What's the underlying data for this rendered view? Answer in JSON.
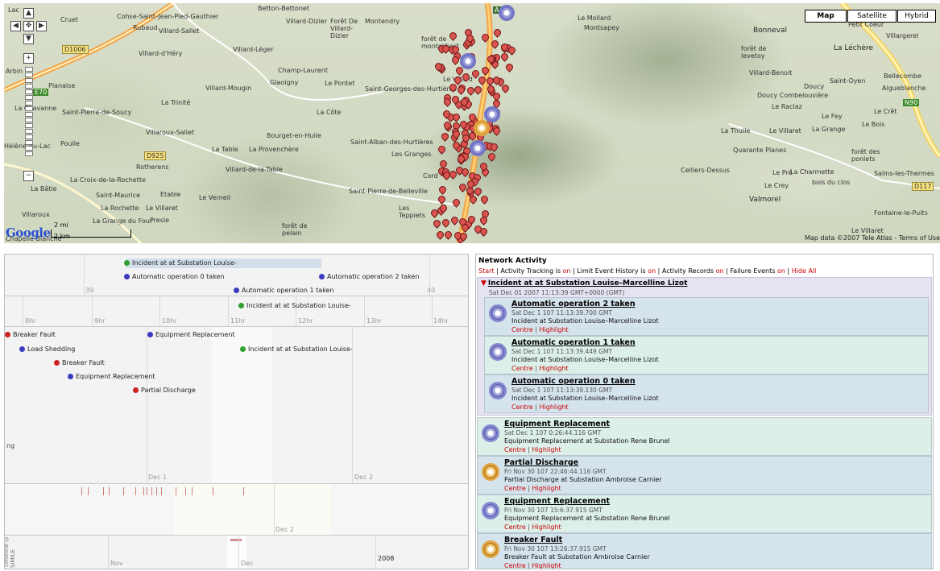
{
  "map": {
    "type_buttons": {
      "map": "Map",
      "satellite": "Satellite",
      "hybrid": "Hybrid"
    },
    "scale": {
      "miles": "2 mi",
      "km": "2 km"
    },
    "logo": "Google",
    "copyright": "Map data ©2007 Tele Atlas - Terms of Use",
    "places": [
      "Lac",
      "Cruet",
      "Cohse-Saint-Jean-Pied-Gauthier",
      "Rubaud",
      "Villard-Sallet",
      "Villard-Dizier",
      "Forêt De Villard-Dizier",
      "Montendry",
      "Betton-Bettonet",
      "forêt de montgilbert",
      "Le Mollard",
      "Montsapey",
      "Bonneval",
      "Petit Coeur",
      "Villargerel",
      "La Léchère",
      "forêt de levetoy",
      "Saint-Oyen",
      "Bellecombe",
      "Aigueblanche",
      "Villard-Benoit",
      "Doucy",
      "Doucy Combelouvière",
      "Le Raclaz",
      "Le Crêt",
      "Le Fey",
      "Le Bois",
      "La Thuile",
      "Le Villaret",
      "La Grange",
      "Quarante Planes",
      "forêt des ponlets",
      "Celliers-Dessus",
      "Le Pré",
      "La Charmette",
      "bois du clos",
      "Salins-les-Thermes",
      "Le Crey",
      "Valmorel",
      "Fontaine-le-Puits",
      "Le Villaret",
      "Arbin",
      "Planaise",
      "La Chavanne",
      "Saint-Pierre-de-Soucy",
      "La Trinité",
      "Villard-d'Héry",
      "Villard-Léger",
      "Champ-Laurent",
      "Le Pontet",
      "Saint-Georges-des-Hurtières",
      "Le Villard",
      "Villard-Mougin",
      "Glaoigny",
      "La Côte",
      "Bourget-en-Huile",
      "Saint-Alban-des-Hurtières",
      "Les Granges",
      "Hélène-du-Lac",
      "Poulle",
      "Villaroux-Sallet",
      "La Table",
      "La Provenchère",
      "Rotherens",
      "Villard-de-la-Table",
      "La Croix-de-la-Rochette",
      "Le Verneil",
      "Saint-Maurice",
      "Etable",
      "La Rochette",
      "Le Villaret",
      "Villaroux",
      "La Grange du Four",
      "Presle",
      "forêt de pelain",
      "Les Teppiets",
      "Saint-Pierre-de-Belleville",
      "Cord",
      "Chapelle-Blanche",
      "La Bâtie"
    ],
    "roads": [
      "A43",
      "E70",
      "N90",
      "D1006",
      "D925",
      "D117"
    ]
  },
  "timeline": {
    "band1": {
      "labels": [
        "39",
        "40"
      ],
      "events": [
        {
          "text": "Incident at at Substation Louise-",
          "color": "green"
        },
        {
          "text": "Automatic operation 0 taken",
          "color": "blue"
        },
        {
          "text": "Automatic operation 2 taken",
          "color": "blue"
        },
        {
          "text": "Automatic operation 1 taken",
          "color": "blue"
        }
      ]
    },
    "band2": {
      "hours": [
        "8hr",
        "9hr",
        "10hr",
        "11hr",
        "12hr",
        "13hr",
        "14hr"
      ],
      "events": [
        {
          "text": "Incident at at Substation Louise-",
          "color": "green"
        }
      ]
    },
    "band3": {
      "labels": [
        "Dec 1",
        "Dec 2"
      ],
      "side_label": "ng",
      "events": [
        {
          "text": "Breaker Fault",
          "color": "red"
        },
        {
          "text": "Equipment Replacement",
          "color": "blue"
        },
        {
          "text": "Load Shedding",
          "color": "blue"
        },
        {
          "text": "Incident at at Substation Louise-",
          "color": "green"
        },
        {
          "text": "Breaker Fault",
          "color": "red"
        },
        {
          "text": "Equipment Replacement",
          "color": "blue"
        },
        {
          "text": "Partial Discharge",
          "color": "red"
        }
      ]
    },
    "band4": {
      "label": "Dec 2"
    },
    "band5": {
      "labels": [
        "Nov",
        "Dec",
        "2008"
      ],
      "credit": "Timeline © SIMILE"
    }
  },
  "activity": {
    "title": "Network Activity",
    "toolbar": {
      "start": "Start",
      "tracking": "Activity Tracking is",
      "tracking_state": "on",
      "limit": "Limit Event History is",
      "limit_state": "on",
      "records": "Activity Records",
      "records_state": "on",
      "failure": "Failure Events",
      "failure_state": "on",
      "hide": "Hide All"
    },
    "incident": {
      "title": "Incident at at Substation Louise–Marcelline Lizot",
      "date": "Sat Dec 01 2007 11:13:39 GMT+0000 (GMT)"
    },
    "children": [
      {
        "title": "Automatic operation 2 taken",
        "date": "Sat Dec 1 107 11:13:39.700 GMT",
        "desc": "Incident at Substation Louise–Marcelline Lizot",
        "centre": "Centre",
        "highlight": "Highlight"
      },
      {
        "title": "Automatic operation 1 taken",
        "date": "Sat Dec 1 107 11:13:39.449 GMT",
        "desc": "Incident at Substation Louise–Marcelline Lizot",
        "centre": "Centre",
        "highlight": "Highlight"
      },
      {
        "title": "Automatic operation 0 taken",
        "date": "Sat Dec 1 107 11:13:39.130 GMT",
        "desc": "Incident at Substation Louise–Marcelline Lizot",
        "centre": "Centre",
        "highlight": "Highlight"
      }
    ],
    "items": [
      {
        "title": "Equipment Replacement",
        "date": "Sat Dec 1 107 0:26:44.116 GMT",
        "desc": "Equipment Replacement at Substation Rene Brunel",
        "centre": "Centre",
        "highlight": "Highlight",
        "icon": "purple"
      },
      {
        "title": "Partial Discharge",
        "date": "Fri Nov 30 107 22:46:44.116 GMT",
        "desc": "Partial Discharge at Substation Ambroise Carnier",
        "centre": "Centre",
        "highlight": "Highlight",
        "icon": "orange"
      },
      {
        "title": "Equipment Replacement",
        "date": "Fri Nov 30 107 15:6:37.915 GMT",
        "desc": "Equipment Replacement at Substation Rene Brunel",
        "centre": "Centre",
        "highlight": "Highlight",
        "icon": "purple"
      },
      {
        "title": "Breaker Fault",
        "date": "Fri Nov 30 107 13:26:37.915 GMT",
        "desc": "Breaker Fault at Substation Ambroise Carnier",
        "centre": "Centre",
        "highlight": "Highlight",
        "icon": "orange"
      }
    ]
  }
}
